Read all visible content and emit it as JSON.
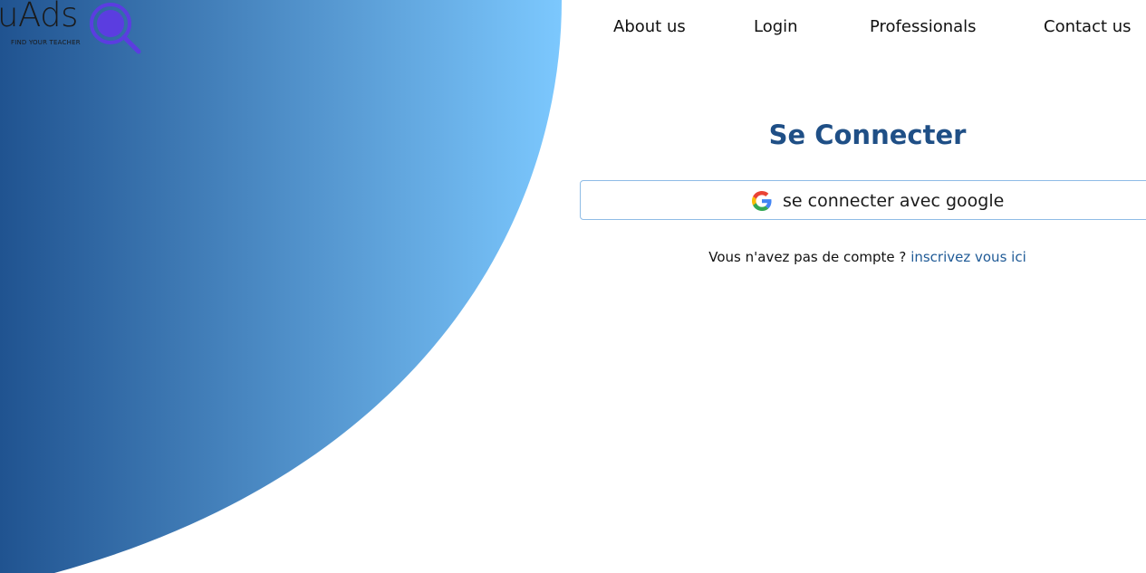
{
  "logo": {
    "wordmark": "uAds",
    "tagline": "FIND YOUR TEACHER"
  },
  "nav": {
    "items": [
      {
        "label": "About us"
      },
      {
        "label": "Login"
      },
      {
        "label": "Professionals"
      },
      {
        "label": "Contact us"
      }
    ]
  },
  "login": {
    "title": "Se Connecter",
    "google_button_label": "se connecter avec google",
    "signup_prompt": "Vous n'avez pas de compte ?",
    "signup_link": "inscrivez vous ici"
  },
  "colors": {
    "gradient_start": "#205390",
    "gradient_end": "#7cc8fe",
    "title": "#1f4f86",
    "link": "#1f5a96",
    "logo_icon": "#5b3de0"
  }
}
